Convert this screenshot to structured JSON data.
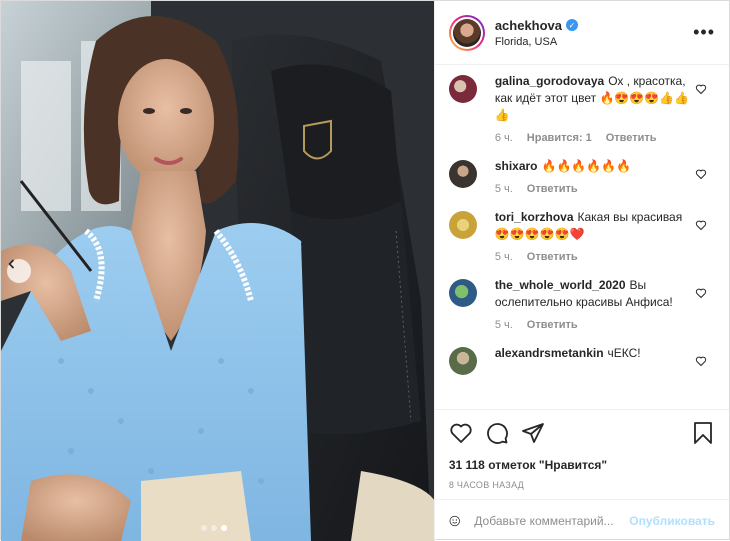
{
  "post": {
    "author": {
      "username": "achekhova",
      "location": "Florida, USA",
      "verified": true
    },
    "media": {
      "carousel_dots": 3,
      "active_dot": 3
    },
    "comments": [
      {
        "username": "galina_gorodovaya",
        "text": "Ох , красотка, как идёт этот цвет 🔥😍😍😍👍👍👍",
        "time": "6 ч.",
        "likes": "Нравится: 1",
        "reply": "Ответить",
        "avatar_color": "#7a2a3a"
      },
      {
        "username": "shixaro",
        "text": "🔥🔥🔥🔥🔥🔥",
        "time": "5 ч.",
        "reply": "Ответить",
        "avatar_color": "#3a3330"
      },
      {
        "username": "tori_korzhova",
        "text": "Какая вы красивая 😍😍😍😍😍❤️",
        "time": "5 ч.",
        "reply": "Ответить",
        "avatar_color": "#c9a23a"
      },
      {
        "username": "the_whole_world_2020",
        "text": "Вы ослепительно красивы Анфиса!",
        "time": "5 ч.",
        "reply": "Ответить",
        "avatar_color": "#2f5a86"
      },
      {
        "username": "alexandrsmetankin",
        "text": "чЕКС!",
        "time": "",
        "reply": "",
        "avatar_color": "#5a6b4a"
      }
    ],
    "likes_text": "31 118 отметок \"Нравится\"",
    "timestamp": "8 ЧАСОВ НАЗАД",
    "add_comment_placeholder": "Добавьте комментарий...",
    "post_button": "Опубликовать"
  },
  "colors": {
    "link": "#0095f6",
    "post_disabled": "#b2dffc",
    "muted": "#8e8e8e",
    "verified": "#3897f0"
  },
  "icons": [
    "more-icon",
    "heart-icon",
    "comment-icon",
    "share-icon",
    "bookmark-icon",
    "emoji-icon",
    "chevron-left-icon"
  ]
}
